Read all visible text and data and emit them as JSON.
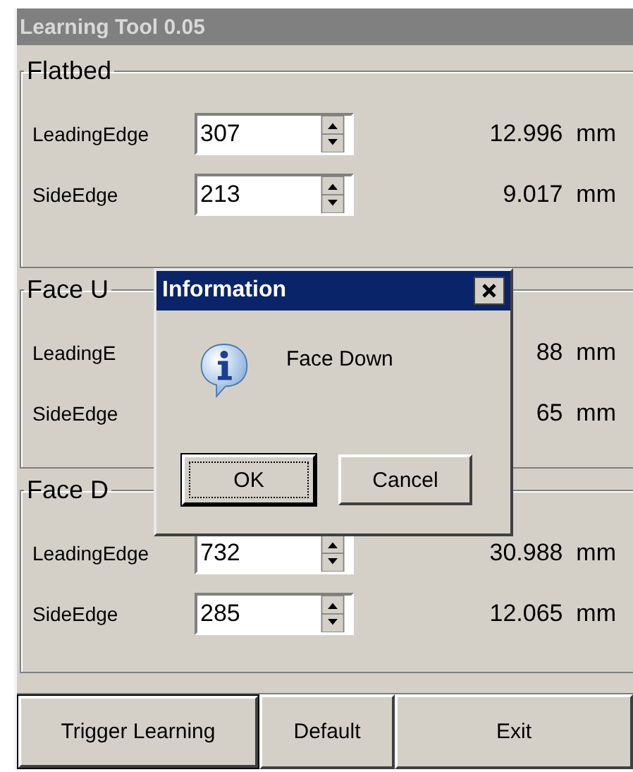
{
  "window": {
    "title": "Learning Tool 0.05",
    "active": false
  },
  "groups": [
    {
      "title": "Flatbed",
      "rows": [
        {
          "label": "LeadingEdge",
          "value": "307",
          "reading": "12.996  mm"
        },
        {
          "label": "SideEdge",
          "value": "213",
          "reading": "9.017  mm"
        }
      ]
    },
    {
      "title": "Face U",
      "rows": [
        {
          "label": "LeadingE",
          "reading": "88  mm"
        },
        {
          "label": "SideEdge",
          "reading": "65  mm"
        }
      ]
    },
    {
      "title": "Face D",
      "rows": [
        {
          "label": "LeadingEdge",
          "value": "732",
          "reading": "30.988  mm"
        },
        {
          "label": "SideEdge",
          "value": "285",
          "reading": "12.065  mm"
        }
      ]
    }
  ],
  "buttons": [
    {
      "label": "Trigger Learning",
      "default": true
    },
    {
      "label": "Default",
      "default": false
    },
    {
      "label": "Exit",
      "default": false
    }
  ],
  "dialog": {
    "title": "Information",
    "message": "Face Down",
    "buttons": [
      {
        "label": "OK",
        "focused": true
      },
      {
        "label": "Cancel",
        "focused": false
      }
    ]
  }
}
